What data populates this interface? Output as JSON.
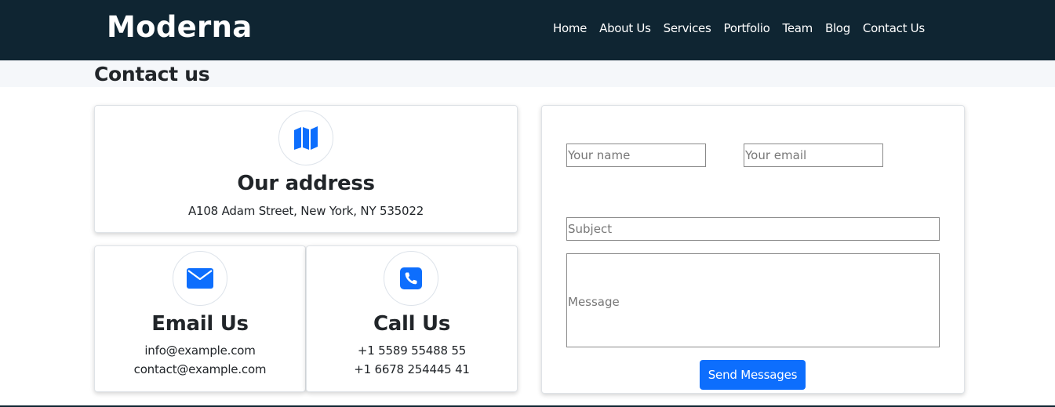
{
  "brand": "Moderna",
  "nav": [
    "Home",
    "About Us",
    "Services",
    "Portfolio",
    "Team",
    "Blog",
    "Contact Us"
  ],
  "page_title": "Contact us",
  "address": {
    "icon": "map-icon",
    "title": "Our address",
    "text": "A108 Adam Street, New York, NY 535022"
  },
  "email": {
    "icon": "envelope-icon",
    "title": "Email Us",
    "lines": [
      "info@example.com",
      "contact@example.com"
    ]
  },
  "call": {
    "icon": "phone-icon",
    "title": "Call Us",
    "lines": [
      "+1 5589 55488 55",
      "+1 6678 254445 41"
    ]
  },
  "form": {
    "name_placeholder": "Your name",
    "email_placeholder": "Your email",
    "subject_placeholder": "Subject",
    "message_placeholder": "Message",
    "submit_label": "Send Messages"
  },
  "colors": {
    "navbar_bg": "#0f2532",
    "accent": "#0d6efd",
    "title_band": "#f5f7fa"
  }
}
